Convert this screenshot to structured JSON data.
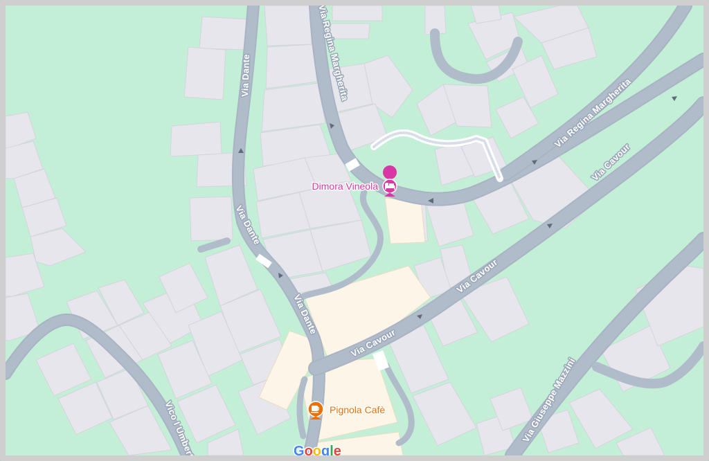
{
  "streets": {
    "via_dante_top": "Via Dante",
    "via_dante_mid": "Via Dante",
    "via_dante_low": "Via Dante",
    "via_regina_margherita_left": "Via Regina Margherita",
    "via_regina_margherita_right": "Via Regina Margherita",
    "via_cavour_top": "Via Cavour",
    "via_cavour_mid": "Via Cavour",
    "via_cavour_low": "Via Cavour",
    "via_giuseppe_mazzini": "Via Giuseppe Mazzini",
    "vico_umberto": "Vico I Umberto"
  },
  "places": [
    {
      "name": "Dimora Vineola",
      "category": "hotel",
      "icon": "bed-icon",
      "color": "#d838a6"
    },
    {
      "name": "Pignola Cafè",
      "category": "cafe",
      "icon": "coffee-cup-icon",
      "color": "#e8710a"
    }
  ],
  "attribution": {
    "logo": "Google"
  },
  "colors": {
    "park": "#c3efd6",
    "building": "#e6e6ec",
    "building_highlight": "#fdf6e8",
    "road": "#b1bccb",
    "hotel_pin": "#d838a6",
    "cafe_pin": "#e8710a"
  }
}
